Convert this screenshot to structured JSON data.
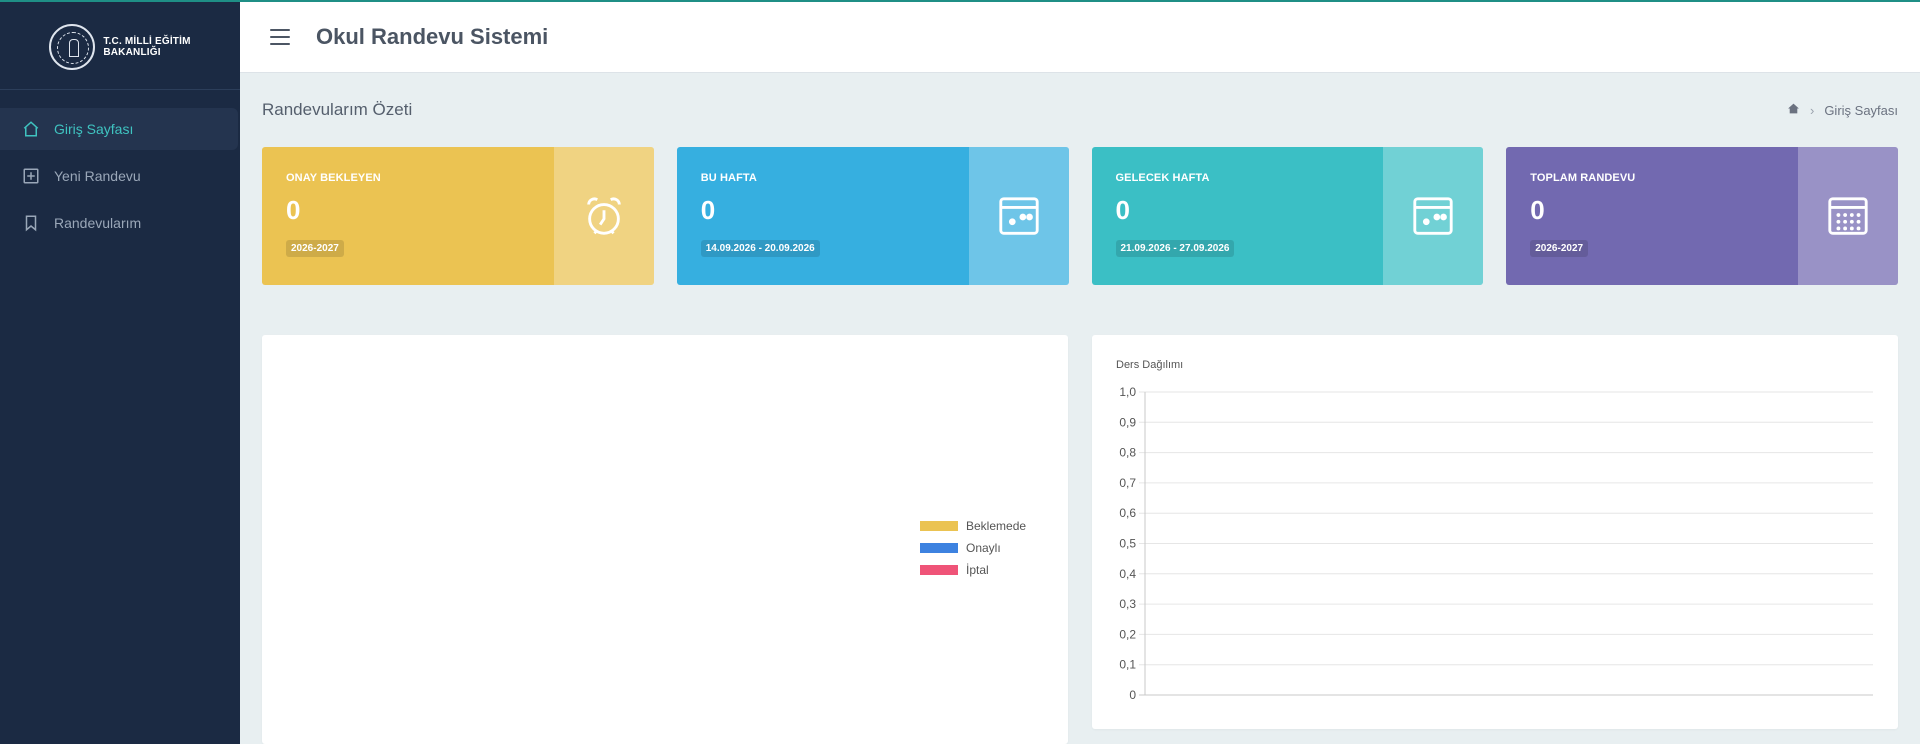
{
  "app": {
    "title": "Okul Randevu Sistemi"
  },
  "brand": {
    "logo_line1": "T.C. MİLLİ EĞİTİM",
    "logo_line2": "BAKANLIĞI"
  },
  "sidebar": {
    "items": [
      {
        "label": "Giriş Sayfası",
        "icon": "home-icon",
        "active": true
      },
      {
        "label": "Yeni Randevu",
        "icon": "plus-square-icon",
        "active": false
      },
      {
        "label": "Randevularım",
        "icon": "bookmark-icon",
        "active": false
      }
    ]
  },
  "page": {
    "title": "Randevularım Özeti",
    "breadcrumb": {
      "current": "Giriş Sayfası"
    }
  },
  "cards": [
    {
      "label": "ONAY BEKLEYEN",
      "value": "0",
      "badge": "2026-2027",
      "color": "#ebc352",
      "icon": "alarm-clock-icon"
    },
    {
      "label": "BU HAFTA",
      "value": "0",
      "badge": "14.09.2026 - 20.09.2026",
      "color": "#36afe0",
      "icon": "calendar-icon"
    },
    {
      "label": "GELECEK HAFTA",
      "value": "0",
      "badge": "21.09.2026 - 27.09.2026",
      "color": "#3bbfc5",
      "icon": "calendar-icon"
    },
    {
      "label": "TOPLAM RANDEVU",
      "value": "0",
      "badge": "2026-2027",
      "color": "#7269b0",
      "icon": "calendar-grid-icon"
    }
  ],
  "status_legend": [
    {
      "label": "Beklemede",
      "color": "#ebc352"
    },
    {
      "label": "Onaylı",
      "color": "#3d82e0"
    },
    {
      "label": "İptal",
      "color": "#ef5478"
    }
  ],
  "chart_data": {
    "type": "bar",
    "title": "Ders Dağılımı",
    "categories": [],
    "series": [],
    "ylim": [
      0,
      1
    ],
    "yticks": [
      "0",
      "0,1",
      "0,2",
      "0,3",
      "0,4",
      "0,5",
      "0,6",
      "0,7",
      "0,8",
      "0,9",
      "1,0"
    ],
    "grid": true
  }
}
